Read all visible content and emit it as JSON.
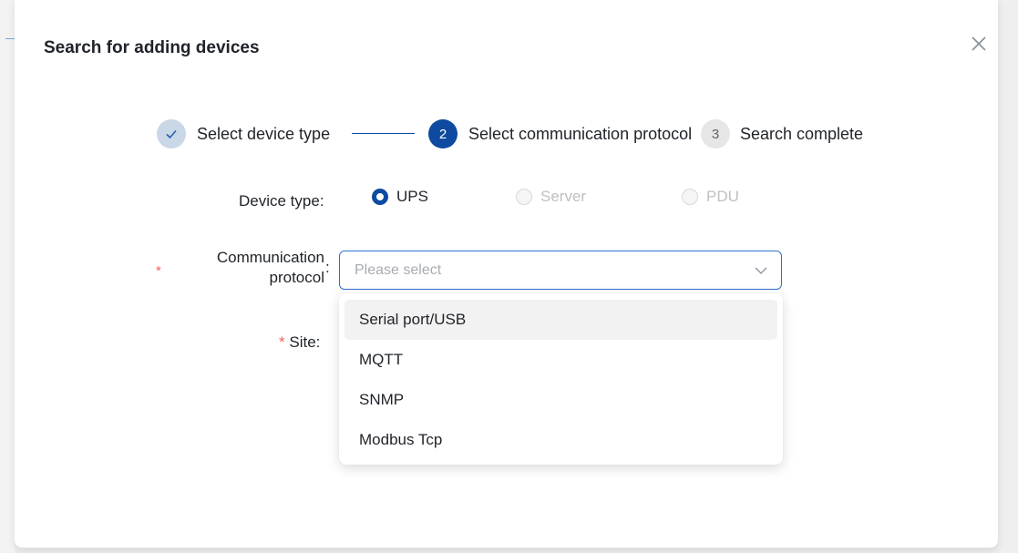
{
  "dialog": {
    "title": "Search for adding devices"
  },
  "steps": [
    {
      "number": "1",
      "label": "Select device type",
      "status": "completed"
    },
    {
      "number": "2",
      "label": "Select communication protocol",
      "status": "active"
    },
    {
      "number": "3",
      "label": "Search complete",
      "status": "pending"
    }
  ],
  "form": {
    "device_type": {
      "label": "Device type:",
      "options": [
        {
          "label": "UPS",
          "checked": true,
          "disabled": false
        },
        {
          "label": "Server",
          "checked": false,
          "disabled": true
        },
        {
          "label": "PDU",
          "checked": false,
          "disabled": true
        }
      ]
    },
    "protocol": {
      "required_mark": "*",
      "label_line1": "Communication",
      "label_line2": "protocol",
      "colon": ":",
      "placeholder": "Please select",
      "options": [
        "Serial port/USB",
        "MQTT",
        "SNMP",
        "Modbus Tcp"
      ],
      "highlighted_index": 0
    },
    "site": {
      "required_mark": "*",
      "label": "Site:"
    }
  },
  "colors": {
    "primary": "#0d4aa0",
    "required": "#f0625a",
    "placeholder": "#a8abb2"
  }
}
